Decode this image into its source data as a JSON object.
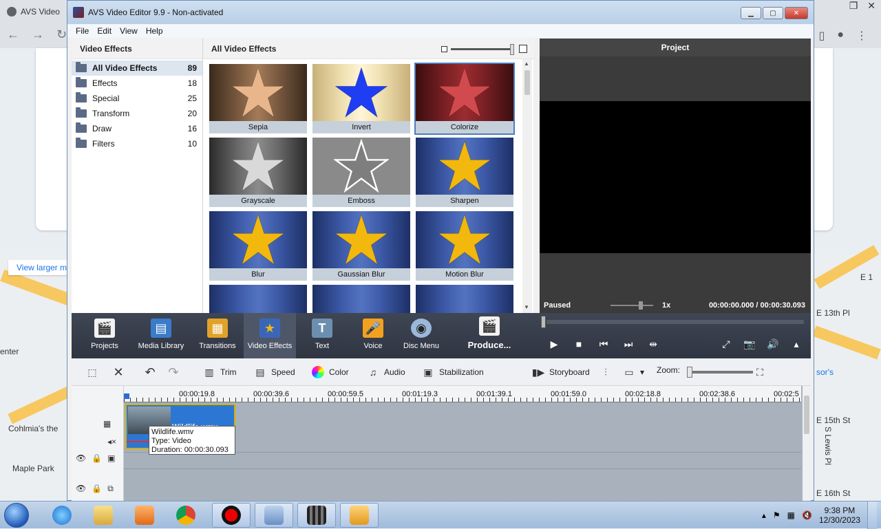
{
  "browser": {
    "tab_title": "AVS Video",
    "map_link": "View larger m",
    "map_labels": [
      "enter",
      "Cohlmia's the",
      "Maple Park",
      "E 1",
      "E 13th Pl",
      "sor's",
      "E 15th St",
      "S Lewis Pl",
      "E 16th St"
    ]
  },
  "app": {
    "title": "AVS Video Editor 9.9 - Non-activated",
    "menu": [
      "File",
      "Edit",
      "View",
      "Help"
    ],
    "left_panel": {
      "title": "Video Effects",
      "categories": [
        {
          "label": "All Video Effects",
          "count": "89"
        },
        {
          "label": "Effects",
          "count": "18"
        },
        {
          "label": "Special",
          "count": "25"
        },
        {
          "label": "Transform",
          "count": "20"
        },
        {
          "label": "Draw",
          "count": "16"
        },
        {
          "label": "Filters",
          "count": "10"
        }
      ]
    },
    "center_panel": {
      "title": "All Video Effects",
      "effects": [
        {
          "label": "Sepia",
          "star_color": "#e9b58a",
          "style": "sepia"
        },
        {
          "label": "Invert",
          "star_color": "#1f3df2",
          "style": "invert"
        },
        {
          "label": "Colorize",
          "star_color": "#d04a4e",
          "style": "colorize"
        },
        {
          "label": "Grayscale",
          "star_color": "#d9d9d9",
          "style": "gray"
        },
        {
          "label": "Emboss",
          "star_color": "#7e7e7e",
          "style": "emboss"
        },
        {
          "label": "Sharpen",
          "star_color": "#f2b80d",
          "style": "blue"
        },
        {
          "label": "Blur",
          "star_color": "#f2b80d",
          "style": "blue"
        },
        {
          "label": "Gaussian Blur",
          "star_color": "#f2b80d",
          "style": "blue"
        },
        {
          "label": "Motion Blur",
          "star_color": "#f2b80d",
          "style": "blue"
        }
      ]
    },
    "preview": {
      "title": "Project",
      "status": "Paused",
      "speed": "1x",
      "time": "00:00:00.000  /  00:00:30.093"
    },
    "main_toolbar": {
      "tools": [
        {
          "label": "Projects"
        },
        {
          "label": "Media Library"
        },
        {
          "label": "Transitions"
        },
        {
          "label": "Video Effects"
        },
        {
          "label": "Text"
        },
        {
          "label": "Voice"
        },
        {
          "label": "Disc Menu"
        },
        {
          "label": "Produce..."
        }
      ]
    },
    "timeline_toolbar": {
      "trim": "Trim",
      "speed": "Speed",
      "color": "Color",
      "audio": "Audio",
      "stabilization": "Stabilization",
      "storyboard": "Storyboard",
      "zoom_label": "Zoom:"
    },
    "timeline": {
      "ruler": [
        "00:00:19.8",
        "00:00:39.6",
        "00:00:59.5",
        "00:01:19.3",
        "00:01:39.1",
        "00:01:59.0",
        "00:02:18.8",
        "00:02:38.6",
        "00:02:5"
      ],
      "clip_name": "Wildlife.wmv",
      "tooltip_line1": "Wildlife.wmv",
      "tooltip_line2": "Type: Video",
      "tooltip_line3": "Duration: 00:00:30.093"
    }
  },
  "taskbar": {
    "time": "9:38 PM",
    "date": "12/30/2023"
  }
}
